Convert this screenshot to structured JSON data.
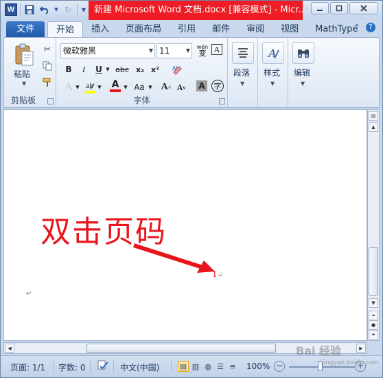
{
  "titlebar": {
    "title": "新建 Microsoft Word 文档.docx [兼容模式] - Micr...",
    "word_logo": "W"
  },
  "tabs": {
    "file": "文件",
    "items": [
      "开始",
      "插入",
      "页面布局",
      "引用",
      "邮件",
      "审阅",
      "视图",
      "MathType"
    ]
  },
  "ribbon": {
    "clipboard": {
      "paste_label": "粘贴",
      "group_label": "剪贴板"
    },
    "font": {
      "font_name": "微软雅黑",
      "font_size": "11",
      "bold": "B",
      "italic": "I",
      "underline": "U",
      "strike": "abc",
      "subscript": "x₂",
      "superscript": "x²",
      "font_color_glyph": "A",
      "change_case": "Aa",
      "grow_font": "A",
      "shrink_font": "A",
      "char_shading": "A",
      "enclose_char": "字",
      "phonetic": "wén",
      "border_char": "A",
      "group_label": "字体"
    },
    "paragraph": {
      "label": "段落"
    },
    "styles": {
      "label": "样式"
    },
    "editing": {
      "label": "编辑"
    }
  },
  "document": {
    "annotation_text": "双击页码",
    "page_number": "1",
    "annotation_color": "#e8161c"
  },
  "statusbar": {
    "page": "页面: 1/1",
    "words": "字数: 0",
    "language": "中文(中国)",
    "zoom": "100%"
  },
  "watermark": {
    "text": "Bai 经验",
    "url": "jingyan.baidu.com"
  },
  "colors": {
    "title_highlight": "#ee1c24",
    "file_tab": "#2b579a",
    "accent": "#1e395b"
  }
}
